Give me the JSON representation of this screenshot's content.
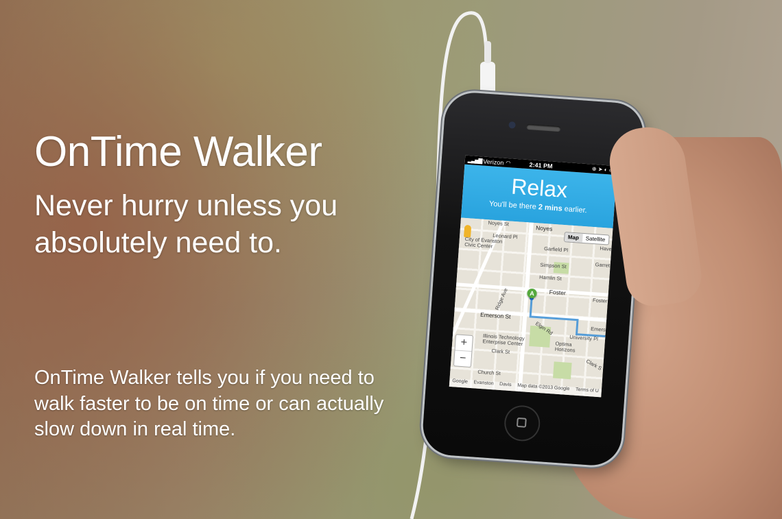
{
  "hero": {
    "title": "OnTime Walker",
    "tagline": "Never hurry unless you absolutely need to.",
    "description": "OnTime Walker tells you if you need to walk faster to be on time or can actually slow down in real time."
  },
  "phone": {
    "statusbar": {
      "carrier": "Verizon",
      "time": "2:41 PM"
    },
    "banner": {
      "title": "Relax",
      "subtitle_prefix": "You'll be there ",
      "subtitle_bold": "2 mins",
      "subtitle_suffix": " earlier.",
      "color": "#29a3de"
    },
    "map": {
      "toggle": {
        "map": "Map",
        "satellite": "Satellite"
      },
      "zoom_in": "+",
      "zoom_out": "−",
      "pin": "A",
      "labels": {
        "noyes_top": "Noyes St",
        "noyes": "Noyes",
        "leonard": "Leonard Pl",
        "civic_center": "City of Evanston Civic Center",
        "garfield": "Garfield Pl",
        "haven": "Haven",
        "simpson": "Simpson St",
        "garrett": "Garrett",
        "hamlin": "Hamlin St",
        "foster": "Foster",
        "ridge": "Ridge Ave",
        "foster_st": "Foster",
        "emerson": "Emerson St",
        "emerson_right": "Emerson",
        "elgin": "Elgin Rd",
        "university": "University Pl",
        "iit": "Illinois Technology Enterprise Center",
        "optima": "Optima Horizons",
        "clark": "Clark St",
        "clark_right": "Clark S",
        "church": "Church St",
        "evanston": "Evanston",
        "davis": "Davis",
        "map_data": "Map data ©2013 Google",
        "terms": "Terms of U",
        "google": "Google"
      },
      "route_color": "#3b8fd6"
    }
  }
}
